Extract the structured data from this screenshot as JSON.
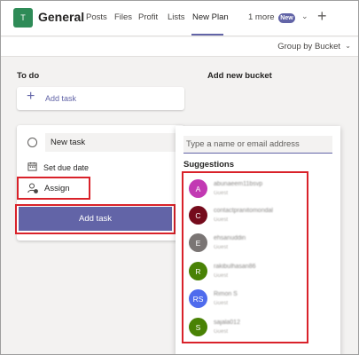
{
  "header": {
    "team_initial": "T",
    "channel": "General",
    "tabs": [
      {
        "label": "Posts"
      },
      {
        "label": "Files"
      },
      {
        "label": "Profit"
      },
      {
        "label": "Lists"
      },
      {
        "label": "New Plan"
      },
      {
        "label": "1 more"
      }
    ],
    "new_badge": "New",
    "accent_color": "#6264a7"
  },
  "toolbar": {
    "group_by": "Group by Bucket"
  },
  "board": {
    "todo_title": "To do",
    "new_bucket_title": "Add new bucket",
    "add_task_label": "Add task",
    "task_card": {
      "name_value": "New task",
      "due_label": "Set due date",
      "assign_label": "Assign",
      "submit_label": "Add task"
    }
  },
  "assign_popup": {
    "search_placeholder": "Type a name or email address",
    "suggestions_title": "Suggestions",
    "people": [
      {
        "initials": "A",
        "color": "#c239b3",
        "name": "abunaeem11bsvp",
        "role": "Guest"
      },
      {
        "initials": "C",
        "color": "#750b1c",
        "name": "contactpranitomondal",
        "role": "Guest"
      },
      {
        "initials": "E",
        "color": "#7a7574",
        "name": "ehsanuddin",
        "role": "Guest"
      },
      {
        "initials": "R",
        "color": "#498205",
        "name": "rakibulhasan86",
        "role": "Guest"
      },
      {
        "initials": "RS",
        "color": "#4f6bed",
        "name": "Rimon S",
        "role": "Guest"
      },
      {
        "initials": "S",
        "color": "#498205",
        "name": "sajala012",
        "role": "Guest"
      }
    ]
  }
}
